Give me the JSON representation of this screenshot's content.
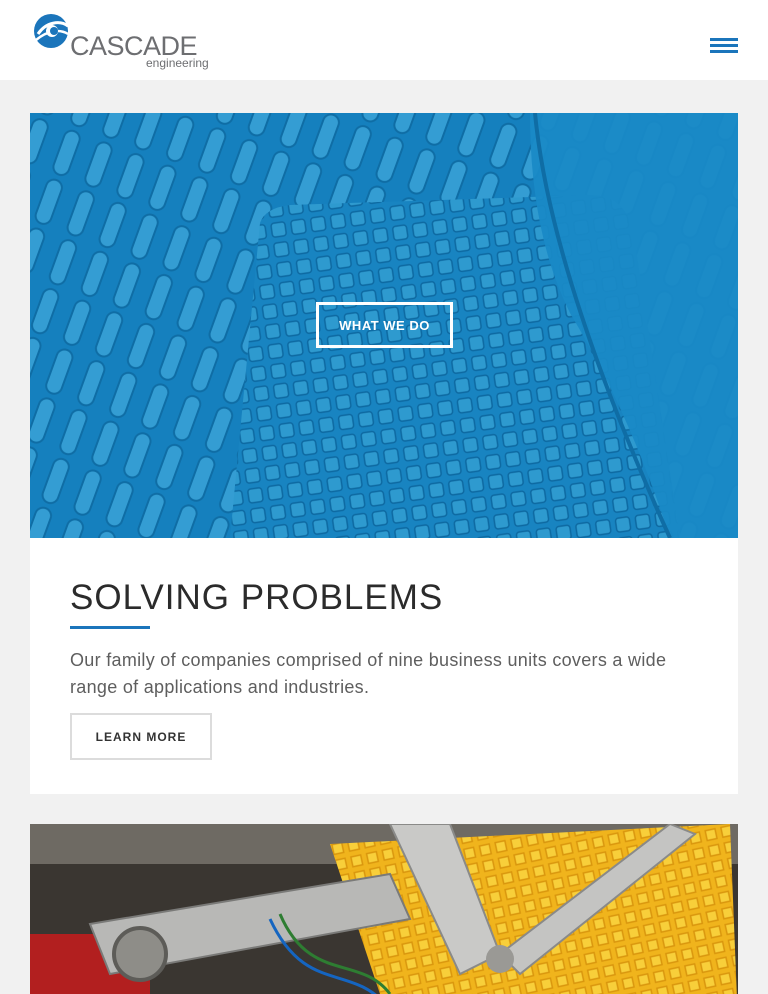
{
  "header": {
    "logo_word": "CASCADE",
    "logo_sub": "engineering",
    "menu_icon": "hamburger-menu-icon"
  },
  "colors": {
    "brand_blue": "#1b75bb",
    "hero_blue": "#1684c4",
    "page_bg": "#f1f1f1"
  },
  "card1": {
    "hero_button": "WHAT WE DO",
    "title": "SOLVING PROBLEMS",
    "description": "Our family of companies comprised of nine business units covers a wide range of applications and industries.",
    "cta": "LEARN MORE"
  }
}
